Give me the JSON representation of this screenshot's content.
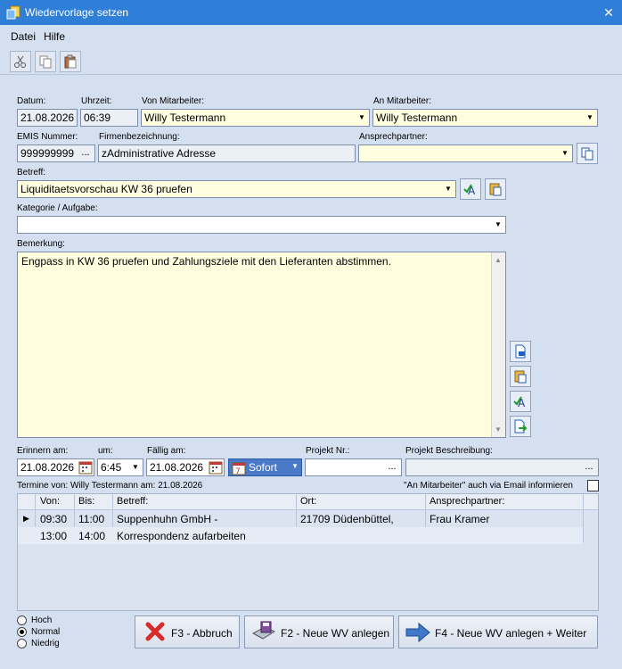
{
  "window": {
    "title": "Wiedervorlage setzen",
    "close_glyph": "✕"
  },
  "menu": {
    "items": [
      "Datei",
      "Hilfe"
    ]
  },
  "toolbar": {
    "icons": [
      "scissors-icon",
      "copy-icon",
      "paste-icon"
    ]
  },
  "form": {
    "datum_label": "Datum:",
    "datum": "21.08.2026",
    "uhrzeit_label": "Uhrzeit:",
    "uhrzeit": "06:39",
    "von_label": "Von Mitarbeiter:",
    "von": "Willy Testermann",
    "an_label": "An Mitarbeiter:",
    "an": "Willy Testermann",
    "emis_label": "EMIS Nummer:",
    "emis": "999999999",
    "firma_label": "Firmenbezeichnung:",
    "firma": "zAdministrative Adresse",
    "ansprech_label": "Ansprechpartner:",
    "ansprech": "",
    "betreff_label": "Betreff:",
    "betreff": "Liquiditaetsvorschau KW 36 pruefen",
    "kategorie_label": "Kategorie / Aufgabe:",
    "kategorie": "",
    "bemerkung_label": "Bemerkung:",
    "bemerkung": "Engpass in KW 36 pruefen und Zahlungsziele mit den Lieferanten abstimmen.",
    "erinnern_label": "Erinnern am:",
    "erinnern": "21.08.2026",
    "um_label": "um:",
    "um": "6:45",
    "faellig_label": "Fällig am:",
    "faellig": "21.08.2026",
    "sofort": "Sofort",
    "projekt_nr_label": "Projekt Nr.:",
    "projekt_nr": "",
    "projekt_beschr_label": "Projekt Beschreibung:",
    "projekt_beschr": "",
    "ellipsis": "...",
    "termine_text": "Termine von: Willy Testermann am: 21.08.2026",
    "email_label": "\"An Mitarbeiter\" auch via Email informieren",
    "email_checked": false
  },
  "table": {
    "columns": [
      "Von:",
      "Bis:",
      "Betreff:",
      "Ort:",
      "Ansprechpartner:"
    ],
    "rows": [
      {
        "von": "09:30",
        "bis": "11:00",
        "betreff": "Suppenhuhn GmbH -",
        "ort": "21709 Düdenbüttel,",
        "ansprech": "Frau Kramer",
        "selected": true
      },
      {
        "von": "13:00",
        "bis": "14:00",
        "betreff": "Korrespondenz aufarbeiten",
        "ort": "",
        "ansprech": "",
        "selected": false
      }
    ]
  },
  "priority": {
    "options": [
      "Hoch",
      "Normal",
      "Niedrig"
    ],
    "selected": "Normal"
  },
  "buttons": {
    "abbruch": "F3 - Abbruch",
    "neue_wv": "F2 - Neue WV anlegen",
    "neue_wv_weiter": "F4 - Neue WV anlegen + Weiter"
  },
  "colors": {
    "title_bar": "#2f7fd8",
    "background": "#d4dff0",
    "yellow_field": "#ffffe0"
  }
}
